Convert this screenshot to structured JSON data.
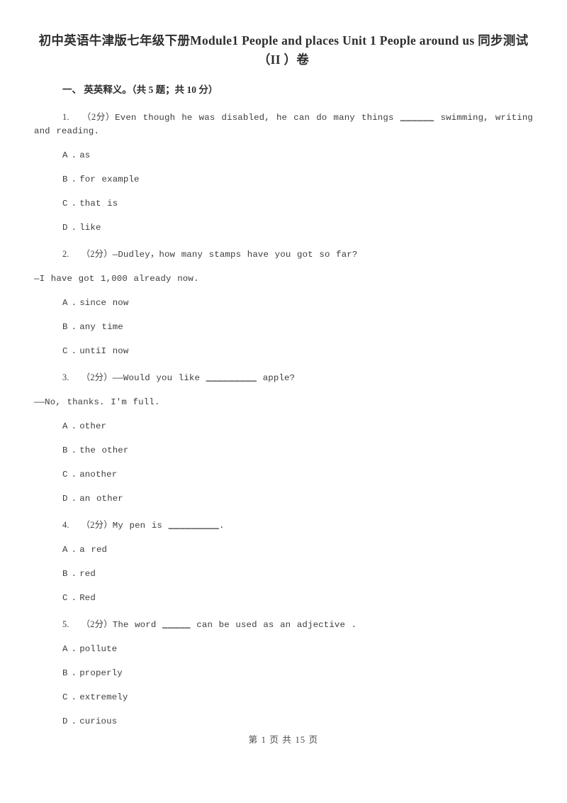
{
  "document": {
    "title": "初中英语牛津版七年级下册Module1 People and places Unit 1 People around us 同步测试（II ）卷",
    "footer": "第 1 页 共 15 页"
  },
  "sections": [
    {
      "heading": "一、 英英释义。（共 5 题；共 10 分）"
    }
  ],
  "questions": [
    {
      "number": "1.",
      "score": "（2分）",
      "stem_part1": "Even though he was disabled, he can do many things ",
      "blank": "______",
      "stem_part2": " swimming, writing and reading.",
      "continuation": "",
      "options": [
        {
          "letter": "A",
          "dot": ".",
          "text": "as"
        },
        {
          "letter": "B",
          "dot": ".",
          "text": "for example"
        },
        {
          "letter": "C",
          "dot": ".",
          "text": "that is"
        },
        {
          "letter": "D",
          "dot": ".",
          "text": "like"
        }
      ]
    },
    {
      "number": "2.",
      "score": "（2分）",
      "stem_part1": "—Dudley，how many stamps have you got so far?",
      "blank": "",
      "stem_part2": "",
      "continuation": "—I have got 1,000 already now.",
      "options": [
        {
          "letter": "A",
          "dot": ".",
          "text": "since now"
        },
        {
          "letter": "B",
          "dot": ".",
          "text": "any time"
        },
        {
          "letter": "C",
          "dot": ".",
          "text": "untiI now"
        }
      ]
    },
    {
      "number": "3.",
      "score": "（2分）",
      "stem_part1": "——Would you like ",
      "blank": "_________",
      "stem_part2": " apple?",
      "continuation": "——No, thanks. I'm full.",
      "options": [
        {
          "letter": "A",
          "dot": ".",
          "text": "other"
        },
        {
          "letter": "B",
          "dot": ".",
          "text": "the other"
        },
        {
          "letter": "C",
          "dot": ".",
          "text": "another"
        },
        {
          "letter": "D",
          "dot": ".",
          "text": "an other"
        }
      ]
    },
    {
      "number": "4.",
      "score": "（2分）",
      "stem_part1": "My pen is ",
      "blank": "_________",
      "stem_part2": ".",
      "continuation": "",
      "options": [
        {
          "letter": "A",
          "dot": ".",
          "text": "a red"
        },
        {
          "letter": "B",
          "dot": ".",
          "text": "red"
        },
        {
          "letter": "C",
          "dot": ".",
          "text": "Red"
        }
      ]
    },
    {
      "number": "5.",
      "score": "（2分）",
      "stem_part1": "The word ",
      "blank": "_____",
      "stem_part2": " can be used as an adjective .",
      "continuation": "",
      "options": [
        {
          "letter": "A",
          "dot": ".",
          "text": "pollute"
        },
        {
          "letter": "B",
          "dot": ".",
          "text": "properly"
        },
        {
          "letter": "C",
          "dot": ".",
          "text": "extremely"
        },
        {
          "letter": "D",
          "dot": ".",
          "text": "curious"
        }
      ]
    }
  ]
}
